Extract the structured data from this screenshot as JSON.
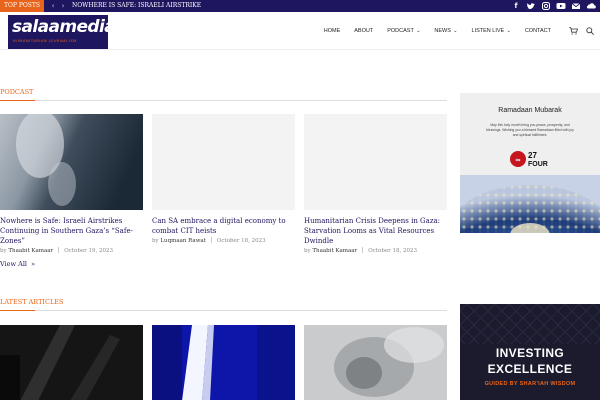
{
  "topbar": {
    "label": "TOP POSTS",
    "prev_arrow": "‹",
    "next_arrow": "›",
    "ticker": "NOWHERE IS SAFE: ISRAELI AIRSTRIKE",
    "socials": [
      "facebook-icon",
      "twitter-icon",
      "instagram-icon",
      "youtube-icon",
      "email-icon",
      "soundcloud-icon"
    ]
  },
  "header": {
    "logo_text": "salaamedia",
    "logo_tagline": "HUMANITARIAN JOURNALISM",
    "nav": {
      "home": "HOME",
      "about": "ABOUT",
      "podcast": "PODCAST",
      "news": "NEWS",
      "listen_live": "LISTEN LIVE",
      "contact": "CONTACT"
    }
  },
  "podcast": {
    "heading": "PODCAST",
    "cards": [
      {
        "title": "Nowhere is Safe: Israeli Airstrikes Continuing in Southern Gaza’s “Safe-Zones”",
        "author": "Thaabit Kamaar",
        "by": "by",
        "date": "October 19, 2023"
      },
      {
        "title": "Can SA embrace a digital economy to combat CIT heists",
        "author": "Luqmaan Rawat",
        "by": "by",
        "date": "October 18, 2023"
      },
      {
        "title": "Humanitarian Crisis Deepens in Gaza: Starvation Looms as Vital Resources Dwindle",
        "author": "Thaabit Kamaar",
        "by": "by",
        "date": "October 18, 2023"
      }
    ],
    "view_all": "View All"
  },
  "latest": {
    "heading": "LATEST ARTICLES"
  },
  "ads": {
    "ramadaan": {
      "title": "Ramadaan Mubarak",
      "text": "May this holy month bring you peace, prosperity, and blessings. Wishing you a blessed Ramadaan filled with joy and spiritual fulfillment.",
      "brand_number": "27",
      "brand_word": "FOUR"
    },
    "investing": {
      "line1": "INVESTING",
      "line2": "EXCELLENCE",
      "sub": "GUIDED BY SHAR’IAH WISDOM"
    }
  },
  "colors": {
    "brand_navy": "#1f1660",
    "accent_orange": "#e8641a"
  }
}
